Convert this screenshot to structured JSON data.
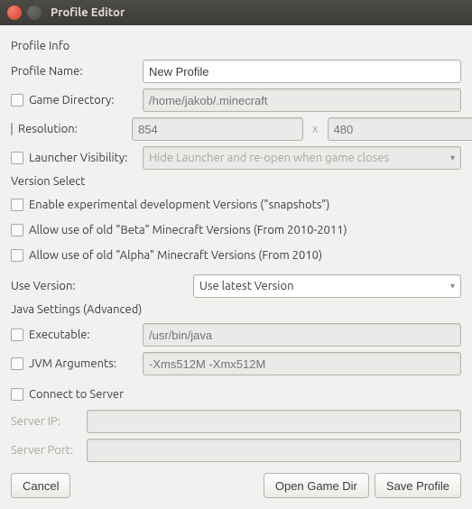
{
  "window": {
    "title": "Profile Editor"
  },
  "section_profile_info": "Profile Info",
  "profile_name": {
    "label": "Profile Name:",
    "value": "New Profile"
  },
  "game_dir": {
    "label": "Game Directory:",
    "placeholder": "/home/jakob/.minecraft"
  },
  "resolution": {
    "label": "Resolution:",
    "width_placeholder": "854",
    "x": "x",
    "height_placeholder": "480"
  },
  "launcher_vis": {
    "label": "Launcher Visibility:",
    "value": "Hide Launcher and re-open when game closes"
  },
  "section_version": "Version Select",
  "snapshots": {
    "label": "Enable experimental development Versions (\"snapshots\")"
  },
  "beta": {
    "label": "Allow use of old \"Beta\" Minecraft Versions (From 2010-2011)"
  },
  "alpha": {
    "label": "Allow use of old \"Alpha\" Minecraft Versions (From 2010)"
  },
  "use_version": {
    "label": "Use Version:",
    "value": "Use latest Version"
  },
  "section_java": "Java Settings (Advanced)",
  "executable": {
    "label": "Executable:",
    "placeholder": "/usr/bin/java"
  },
  "jvm_args": {
    "label": "JVM Arguments:",
    "placeholder": "-Xms512M -Xmx512M"
  },
  "connect": {
    "label": "Connect to Server"
  },
  "server_ip": {
    "label": "Server IP:"
  },
  "server_port": {
    "label": "Server Port:"
  },
  "buttons": {
    "cancel": "Cancel",
    "open_dir": "Open Game Dir",
    "save": "Save Profile"
  }
}
